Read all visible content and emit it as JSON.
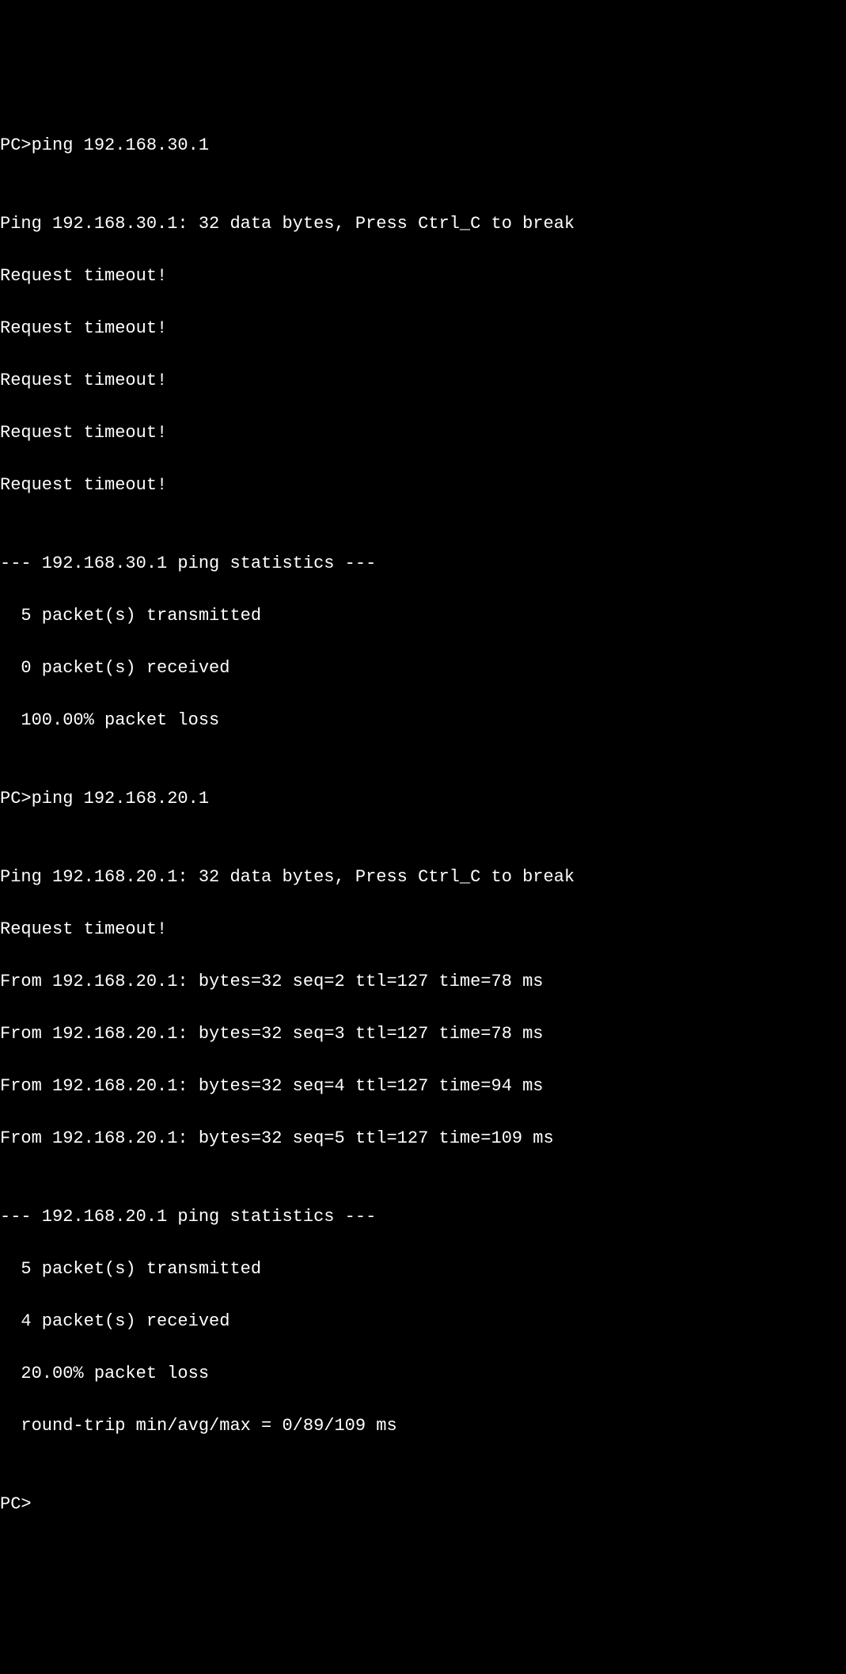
{
  "terminal": {
    "lines": {
      "l0": "PC>ping 192.168.30.1",
      "l1": "",
      "l2": "Ping 192.168.30.1: 32 data bytes, Press Ctrl_C to break",
      "l3": "Request timeout!",
      "l4": "Request timeout!",
      "l5": "Request timeout!",
      "l6": "Request timeout!",
      "l7": "Request timeout!",
      "l8": "",
      "l9": "--- 192.168.30.1 ping statistics ---",
      "l10": "  5 packet(s) transmitted",
      "l11": "  0 packet(s) received",
      "l12": "  100.00% packet loss",
      "l13": "",
      "l14": "PC>ping 192.168.20.1",
      "l15": "",
      "l16": "Ping 192.168.20.1: 32 data bytes, Press Ctrl_C to break",
      "l17": "Request timeout!",
      "l18": "From 192.168.20.1: bytes=32 seq=2 ttl=127 time=78 ms",
      "l19": "From 192.168.20.1: bytes=32 seq=3 ttl=127 time=78 ms",
      "l20": "From 192.168.20.1: bytes=32 seq=4 ttl=127 time=94 ms",
      "l21": "From 192.168.20.1: bytes=32 seq=5 ttl=127 time=109 ms",
      "l22": "",
      "l23": "--- 192.168.20.1 ping statistics ---",
      "l24": "  5 packet(s) transmitted",
      "l25": "  4 packet(s) received",
      "l26": "  20.00% packet loss",
      "l27": "  round-trip min/avg/max = 0/89/109 ms",
      "l28": "",
      "l29": "PC>"
    }
  }
}
